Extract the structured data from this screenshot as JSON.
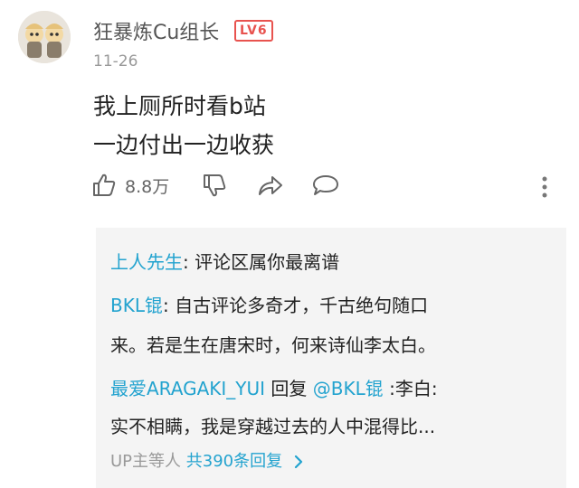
{
  "comment": {
    "username": "狂暴炼Cu组长",
    "level_badge": "LV6",
    "date": "11-26",
    "content_lines": [
      "我上厕所时看b站",
      "一边付出一边收获"
    ],
    "like_count": "8.8万",
    "icons": {
      "like": "thumbs-up-icon",
      "dislike": "thumbs-down-icon",
      "share": "share-arrow-icon",
      "reply": "speech-bubble-icon",
      "more": "more-vertical-icon"
    }
  },
  "replies": [
    {
      "user": "上人先生",
      "sep": ": ",
      "text": "评论区属你最离谱"
    },
    {
      "user": "BKL锟",
      "sep": ": ",
      "text": "自古评论多奇才，千古绝句随口",
      "text2": "来。若是生在唐宋时，何来诗仙李太白。"
    },
    {
      "user": "最爱ARAGAKI_YUI",
      "mid": " 回复 ",
      "mention": "@BKL锟",
      "text": " :李白:",
      "text2": "实不相瞒，我是穿越过去的人中混得比..."
    }
  ],
  "reply_footer": {
    "up_label": "UP主等人",
    "total": "共390条回复",
    "chevron": "chevron-right-icon"
  },
  "colors": {
    "link_blue": "#23a3cf",
    "badge_red": "#e8534f",
    "meta_gray": "#999999",
    "reply_bg": "#f4f4f4"
  }
}
